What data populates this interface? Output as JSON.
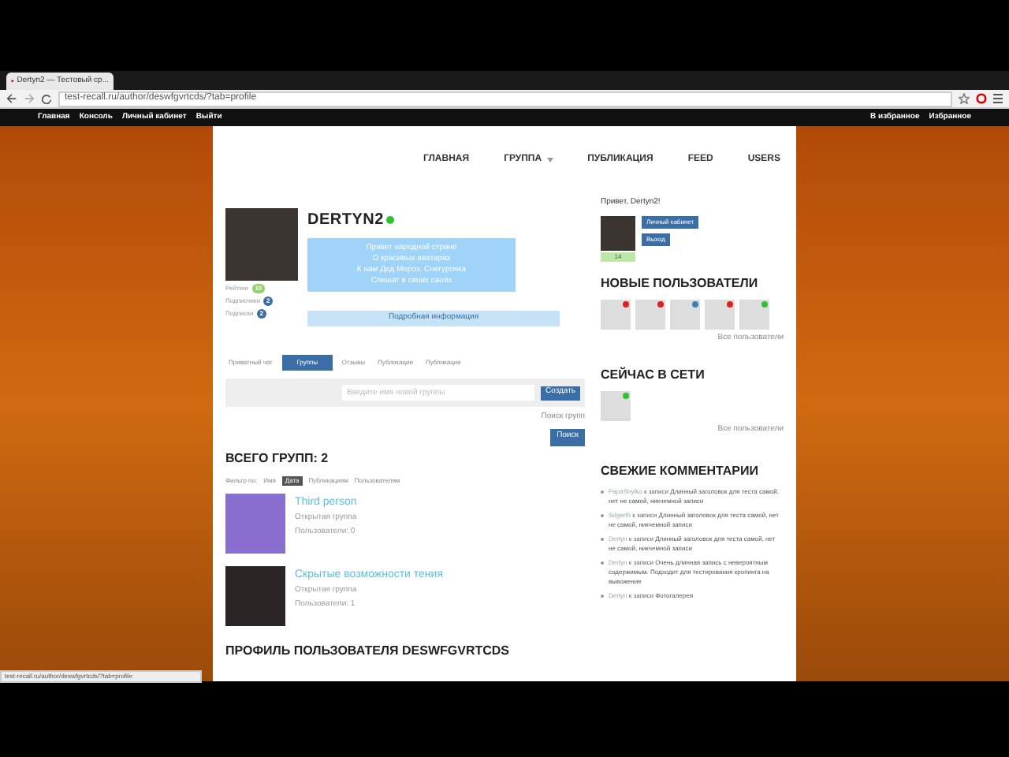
{
  "browser": {
    "tab_title": "Dertyn2 — Тестовый ср...",
    "url": "test-recall.ru/author/deswfgvrtcds/?tab=profile",
    "status_url": "test-recall.ru/author/deswfgvrtcds/?tab=profile"
  },
  "topbar": {
    "left": [
      {
        "label": "Главная"
      },
      {
        "label": "Консоль"
      },
      {
        "label": "Личный кабинет"
      },
      {
        "label": "Выйти"
      }
    ],
    "right": [
      {
        "label": "В избранное"
      },
      {
        "label": "Избранное"
      }
    ]
  },
  "nav": [
    {
      "label": "ГЛАВНАЯ",
      "dropdown": false
    },
    {
      "label": "ГРУППА",
      "dropdown": true
    },
    {
      "label": "ПУБЛИКАЦИЯ",
      "dropdown": false
    },
    {
      "label": "FEED",
      "dropdown": false
    },
    {
      "label": "USERS",
      "dropdown": false
    }
  ],
  "profile": {
    "name": "DERTYN2",
    "online": true,
    "status_lines": [
      "Привет народной стране",
      "О красивых аватарах",
      "К нам Дед Мороз, Снегурочка",
      "Спешат в своих санях"
    ],
    "stats": [
      {
        "label": "Рейтинг",
        "count": "10",
        "color": "#8fd16a"
      },
      {
        "label": "Подписчики",
        "count": "2",
        "color": "#3a6ea5"
      },
      {
        "label": "Подписки",
        "count": "2",
        "color": "#3a6ea5"
      }
    ],
    "details_button": "Подробная информация"
  },
  "tabs": [
    {
      "label": "Приватный чат",
      "selected": false
    },
    {
      "label": "Группы",
      "selected": true
    },
    {
      "label": "Отзывы",
      "selected": false
    },
    {
      "label": "Публикации",
      "selected": false
    },
    {
      "label": "Публикации",
      "selected": false
    }
  ],
  "group_form": {
    "placeholder": "Введите имя новой группы",
    "create_button": "Создать",
    "search_link": "Поиск групп",
    "search_button": "Поиск"
  },
  "groups_heading": "ВСЕГО ГРУПП: 2",
  "filter": {
    "label": "Фильтр по:",
    "options": [
      {
        "label": "Имя",
        "selected": false
      },
      {
        "label": "Дата",
        "selected": true
      },
      {
        "label": "Публикациям",
        "selected": false
      },
      {
        "label": "Пользователям",
        "selected": false
      }
    ]
  },
  "groups": [
    {
      "title": "Third person",
      "type": "Открытая группа",
      "members": "Пользователи: 0"
    },
    {
      "title": "Скрытые возможности тения",
      "type": "Открытая группа",
      "members": "Пользователи: 1"
    }
  ],
  "profile_heading": "ПРОФИЛЬ ПОЛЬЗОВАТЕЛЯ DESWFGVRTCDS",
  "sidebar": {
    "greeting": "Привет, Dertyn2!",
    "buttons": [
      {
        "label": "Личный кабинет"
      },
      {
        "label": "Выход"
      }
    ],
    "rating": "14",
    "new_users_heading": "НОВЫЕ ПОЛЬЗОВАТЕЛИ",
    "new_users": [
      {
        "color": "#e02020"
      },
      {
        "color": "#e02020"
      },
      {
        "color": "#3a7fc0"
      },
      {
        "color": "#e02020"
      },
      {
        "color": "#30c030"
      }
    ],
    "new_users_link": "Все пользователи",
    "online_heading": "СЕЙЧАС В СЕТИ",
    "online_users": [
      {
        "color": "#30c030"
      }
    ],
    "online_link": "Все пользователи",
    "comments_heading": "СВЕЖИЕ КОММЕНТАРИИ",
    "comments": [
      {
        "author": "PapaShylko",
        "connector": "к записи",
        "title": "Длинный заголовок для теста самой, нет не самой, никчемной записи"
      },
      {
        "author": "Sdgerth",
        "connector": "к записи",
        "title": "Длинный заголовок для теста самой, нет не самой, никчемной записи"
      },
      {
        "author": "Dertyn",
        "connector": "к записи",
        "title": "Длинный заголовок для теста самой, нет не самой, никчемной записи"
      },
      {
        "author": "Dertyn",
        "connector": "к записи",
        "title": "Очень длинная запись с невероятным содержимым. Подходит для тестирования кропинга на вывожение"
      },
      {
        "author": "Dertyn",
        "connector": "к записи",
        "title": "Фотогалерея"
      }
    ]
  }
}
